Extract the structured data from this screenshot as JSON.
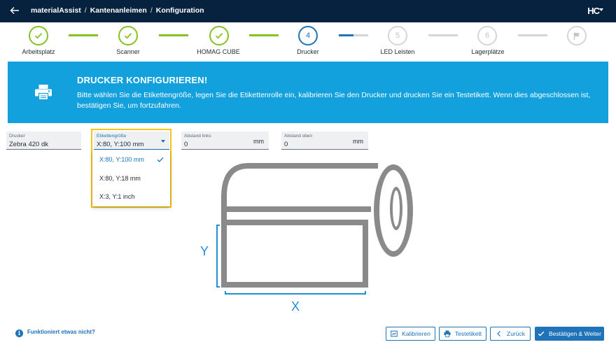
{
  "header": {
    "back_icon": "arrow-left-icon",
    "breadcrumbs": [
      "materialAssist",
      "Kantenanleimen",
      "Konfiguration"
    ],
    "logo": "HC"
  },
  "stepper": {
    "steps": [
      {
        "label": "Arbeitsplatz",
        "state": "done"
      },
      {
        "label": "Scanner",
        "state": "done"
      },
      {
        "label": "HOMAG CUBE",
        "state": "done"
      },
      {
        "label": "Drucker",
        "number": "4",
        "state": "active"
      },
      {
        "label": "LED Leisten",
        "number": "5",
        "state": "todo"
      },
      {
        "label": "Lagerplätze",
        "number": "6",
        "state": "todo"
      },
      {
        "label": "",
        "icon": "flag-icon",
        "state": "todo"
      }
    ],
    "colors": {
      "done": "#84c225",
      "active": "#1e73b9",
      "todo": "#d3d6da"
    }
  },
  "banner": {
    "icon": "printer-icon",
    "title": "DRUCKER KONFIGURIEREN!",
    "text": "Bitte wählen Sie die Etikettengröße, legen Sie die Etikettenrolle ein, kalibrieren Sie den Drucker und drucken Sie ein Testetikett. Wenn dies abgeschlossen ist, bestätigen Sie, um fortzufahren.",
    "color": "#13a1de"
  },
  "form": {
    "printer": {
      "label": "Drucker",
      "value": "Zebra 420 dk"
    },
    "label_size": {
      "label": "Etikettengröße",
      "value": "X:80, Y:100 mm",
      "options": [
        {
          "label": "X:80, Y:100 mm",
          "selected": true
        },
        {
          "label": "X:80, Y:18 mm",
          "selected": false
        },
        {
          "label": "X:3, Y:1 inch",
          "selected": false
        }
      ]
    },
    "offset_left": {
      "label": "Abstand links",
      "value": "0",
      "unit": "mm"
    },
    "offset_top": {
      "label": "Abstand oben",
      "value": "0",
      "unit": "mm"
    }
  },
  "illustration": {
    "y_label": "Y",
    "x_label": "X",
    "accent": "#1e90d6"
  },
  "footer": {
    "help_text": "Funktioniert etwas nicht?",
    "buttons": {
      "calibrate": "Kalibrieren",
      "test_label": "Testetikett",
      "back": "Zurück",
      "confirm": "Bestätigen & Weiter"
    }
  }
}
